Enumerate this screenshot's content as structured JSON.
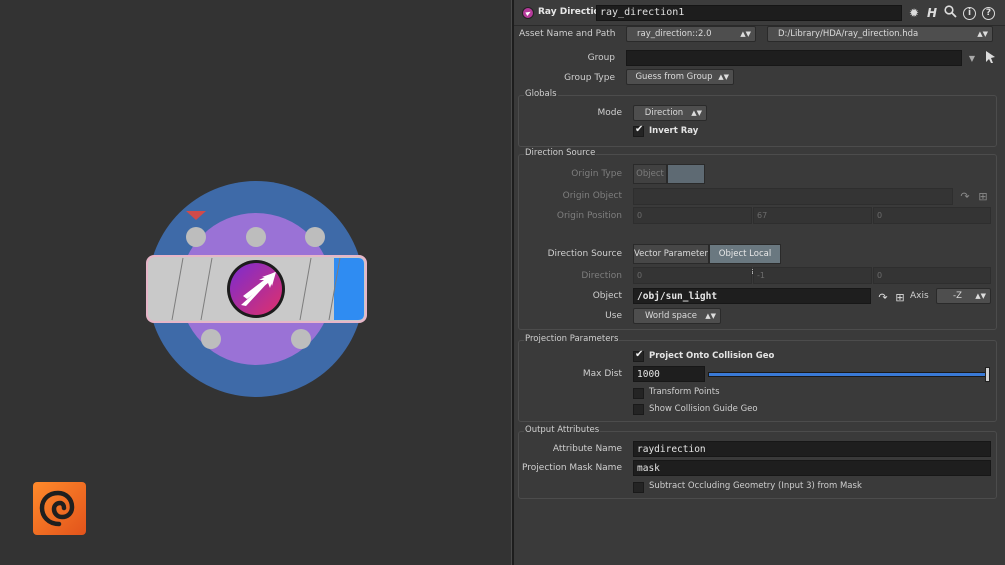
{
  "header": {
    "node_type": "Ray Direction",
    "node_name": "ray_direction1"
  },
  "asset": {
    "label": "Asset Name and Path",
    "name": "ray_direction::2.0",
    "path": "D:/Library/HDA/ray_direction.hda"
  },
  "group": {
    "label": "Group",
    "value": ""
  },
  "group_type": {
    "label": "Group Type",
    "value": "Guess from Group"
  },
  "globals": {
    "title": "Globals",
    "mode_label": "Mode",
    "mode_value": "Direction",
    "invert_ray_label": "Invert Ray",
    "invert_ray_checked": true
  },
  "direction_source_folder": {
    "title": "Direction Source",
    "origin_type_label": "Origin Type",
    "origin_type_value": "Object",
    "origin_object_label": "Origin Object",
    "origin_position_label": "Origin Position",
    "origin_position": [
      "0",
      "67",
      "0"
    ],
    "direction_source_label": "Direction Source",
    "direction_source_options": [
      "Vector Parameter",
      "Object Local Axis"
    ],
    "direction_source_selected": "Object Local Axis",
    "direction_label": "Direction",
    "direction": [
      "0",
      "-1",
      "0"
    ],
    "object_label": "Object",
    "object_value": "/obj/sun_light",
    "axis_label": "Axis",
    "axis_value": "-Z",
    "use_label": "Use",
    "use_value": "World space"
  },
  "projection": {
    "title": "Projection Parameters",
    "project_label": "Project Onto Collision Geo",
    "project_checked": true,
    "max_dist_label": "Max Dist",
    "max_dist_value": "1000",
    "max_dist_slider": 1.0,
    "transform_points_label": "Transform Points",
    "transform_points_checked": false,
    "show_guide_label": "Show Collision Guide Geo",
    "show_guide_checked": false
  },
  "output": {
    "title": "Output Attributes",
    "attr_name_label": "Attribute Name",
    "attr_name_value": "raydirection",
    "mask_name_label": "Projection Mask Name",
    "mask_name_value": "mask",
    "subtract_label": "Subtract Occluding Geometry (Input 3) from Mask",
    "subtract_checked": false
  },
  "colors": {
    "node_outer": "#3e6aa8",
    "node_inner": "#9a72d6",
    "node_body": "#c9c9c9",
    "node_flag": "#2f8cf2",
    "node_icon_a": "#d62d6e",
    "node_icon_b": "#7a2cd0",
    "accent_slider": "#3a7ad6"
  }
}
